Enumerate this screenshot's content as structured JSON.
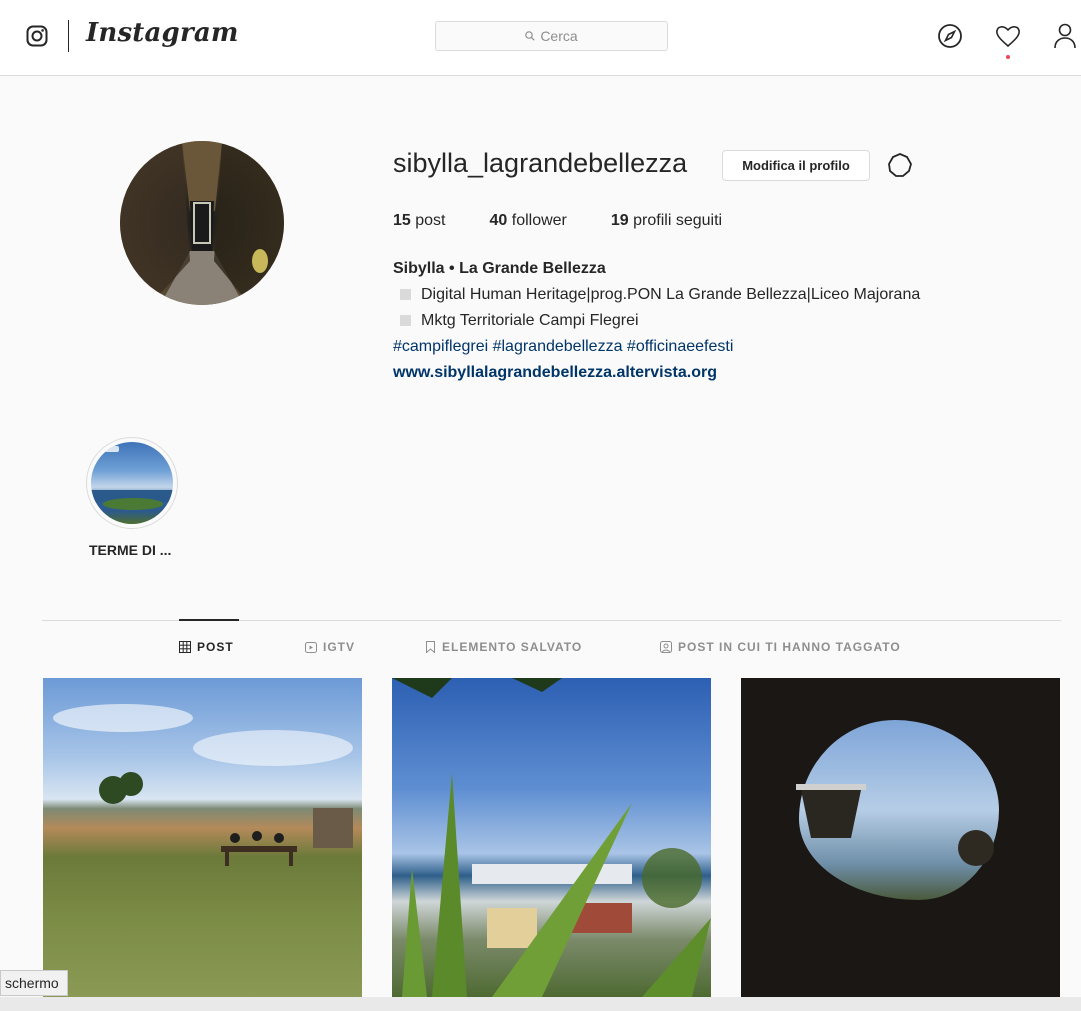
{
  "nav": {
    "brand": "Instagram",
    "search_placeholder": "Cerca"
  },
  "profile": {
    "username": "sibylla_lagrandebellezza",
    "edit_button": "Modifica il profilo",
    "stats": {
      "posts_count": "15",
      "posts_label": "post",
      "followers_count": "40",
      "followers_label": "follower",
      "following_count": "19",
      "following_label": "profili seguiti"
    },
    "bio": {
      "full_name": "Sibylla • La Grande Bellezza",
      "line1": "Digital Human Heritage|prog.PON La Grande Bellezza|Liceo Majorana",
      "line2": "Mktg Territoriale Campi Flegrei",
      "hashtags": "#campiflegrei #lagrandebellezza #officinaeefesti",
      "website": "www.sibyllalagrandebellezza.altervista.org"
    }
  },
  "highlights": [
    {
      "label": "TERME DI ..."
    }
  ],
  "tabs": [
    {
      "label": "POST",
      "active": true
    },
    {
      "label": "IGTV",
      "active": false
    },
    {
      "label": "ELEMENTO SALVATO",
      "active": false
    },
    {
      "label": "POST IN CUI TI HANNO TAGGATO",
      "active": false
    }
  ],
  "tooltip": "schermo",
  "colors": {
    "accent_link": "#003569",
    "notification_dot": "#ed4956",
    "border": "#dbdbdb"
  }
}
